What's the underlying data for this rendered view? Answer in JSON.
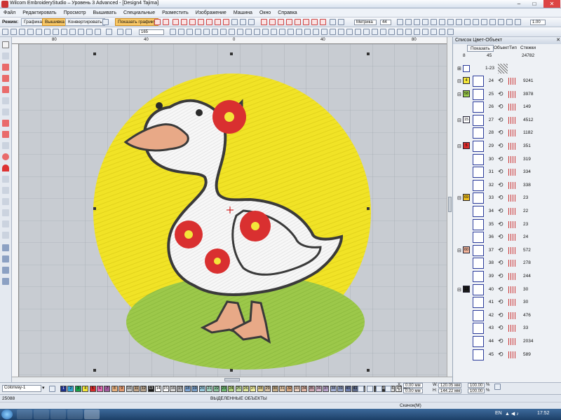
{
  "window": {
    "title": "Wilcom EmbroideryStudio – Уровень 3 Advanced - [Design4     Tajima]"
  },
  "menu": [
    "Файл",
    "Редактировать",
    "Просмотр",
    "Вышивать",
    "Специальные",
    "Разместить",
    "Изображение",
    "Машина",
    "Окно",
    "Справка"
  ],
  "toolbar1": {
    "mode_label": "Режим:",
    "modes": [
      "Графика",
      "Вышивка",
      "Конвертировать"
    ],
    "active_mode": "Вышивка",
    "show_graphic_label": "Показать графику",
    "machine_value": "Метрика",
    "number_value": "44",
    "zoom_value": "1.00"
  },
  "toolbar2": {
    "count_value": "165"
  },
  "ruler_top": [
    "80",
    "40",
    "0",
    "40",
    "80"
  ],
  "panel": {
    "title": "Список Цвет-Объект",
    "show_label": "Показать",
    "col_object": "Объект",
    "col_type": "Тип",
    "col_stitches": "Стежки",
    "stat_colors": "8",
    "stat_objects": "45",
    "stat_total": "24782",
    "group_label": "1-23",
    "rows": [
      {
        "color": "4",
        "num": "24",
        "stitches": "9241",
        "color_hex": "#f4e63a"
      },
      {
        "color": "58",
        "num": "25",
        "stitches": "3978",
        "color_hex": "#9ccd4c"
      },
      {
        "color": "",
        "num": "26",
        "stitches": "149",
        "color_hex": ""
      },
      {
        "color": "15",
        "num": "27",
        "stitches": "4512",
        "color_hex": "#ffffff"
      },
      {
        "color": "",
        "num": "28",
        "stitches": "1182",
        "color_hex": ""
      },
      {
        "color": "5",
        "num": "29",
        "stitches": "351",
        "color_hex": "#d72a2a"
      },
      {
        "color": "",
        "num": "30",
        "stitches": "319",
        "color_hex": ""
      },
      {
        "color": "",
        "num": "31",
        "stitches": "334",
        "color_hex": ""
      },
      {
        "color": "",
        "num": "32",
        "stitches": "338",
        "color_hex": ""
      },
      {
        "color": "69",
        "num": "33",
        "stitches": "23",
        "color_hex": "#f0c020"
      },
      {
        "color": "",
        "num": "34",
        "stitches": "22",
        "color_hex": ""
      },
      {
        "color": "",
        "num": "35",
        "stitches": "23",
        "color_hex": ""
      },
      {
        "color": "",
        "num": "36",
        "stitches": "24",
        "color_hex": ""
      },
      {
        "color": "60",
        "num": "37",
        "stitches": "572",
        "color_hex": "#f2b49a"
      },
      {
        "color": "",
        "num": "38",
        "stitches": "278",
        "color_hex": ""
      },
      {
        "color": "",
        "num": "39",
        "stitches": "244",
        "color_hex": ""
      },
      {
        "color": "13",
        "num": "40",
        "stitches": "30",
        "color_hex": "#1a1a1a"
      },
      {
        "color": "",
        "num": "41",
        "stitches": "30",
        "color_hex": ""
      },
      {
        "color": "",
        "num": "42",
        "stitches": "476",
        "color_hex": ""
      },
      {
        "color": "",
        "num": "43",
        "stitches": "33",
        "color_hex": ""
      },
      {
        "color": "",
        "num": "44",
        "stitches": "2034",
        "color_hex": ""
      },
      {
        "color": "",
        "num": "45",
        "stitches": "589",
        "color_hex": ""
      }
    ]
  },
  "bottom": {
    "colorway": "Colorway-1",
    "swatches": [
      {
        "n": "1",
        "c": "#1c2f8a"
      },
      {
        "n": "2",
        "c": "#34a6d6"
      },
      {
        "n": "3",
        "c": "#1aa04a"
      },
      {
        "n": "4",
        "c": "#f4e63a"
      },
      {
        "n": "5",
        "c": "#d72a2a"
      },
      {
        "n": "6",
        "c": "#e36bb5"
      },
      {
        "n": "7",
        "c": "#a05a9c"
      },
      {
        "n": "8",
        "c": "#e8b07d"
      },
      {
        "n": "9",
        "c": "#e49b72"
      },
      {
        "n": "10",
        "c": "#c7c7c7"
      },
      {
        "n": "11",
        "c": "#c4a78a"
      },
      {
        "n": "12",
        "c": "#b8a58f"
      },
      {
        "n": "13",
        "c": "#1a1a1a"
      },
      {
        "n": "14",
        "c": "#ffffff"
      },
      {
        "n": "15",
        "c": "#ffffff"
      },
      {
        "n": "16",
        "c": "#d9d9d9"
      },
      {
        "n": "17",
        "c": "#aeaeae"
      },
      {
        "n": "18",
        "c": "#7fa8d8"
      },
      {
        "n": "19",
        "c": "#7aa0c9"
      },
      {
        "n": "20",
        "c": "#9acbe0"
      },
      {
        "n": "21",
        "c": "#a6d6c6"
      },
      {
        "n": "22",
        "c": "#88c29b"
      },
      {
        "n": "23",
        "c": "#6fba73"
      },
      {
        "n": "24",
        "c": "#b6d87c"
      },
      {
        "n": "25",
        "c": "#c5e0a0"
      },
      {
        "n": "26",
        "c": "#e0e89a"
      },
      {
        "n": "27",
        "c": "#f0ed9a"
      },
      {
        "n": "28",
        "c": "#e9d792"
      },
      {
        "n": "29",
        "c": "#d8c3a5"
      },
      {
        "n": "30",
        "c": "#c9b08a"
      },
      {
        "n": "31",
        "c": "#e7c9a8"
      },
      {
        "n": "32",
        "c": "#d9a982"
      },
      {
        "n": "33",
        "c": "#f0d4c2"
      },
      {
        "n": "34",
        "c": "#e3b7a5"
      },
      {
        "n": "35",
        "c": "#cfa6b0"
      },
      {
        "n": "36",
        "c": "#d8b8d1"
      },
      {
        "n": "37",
        "c": "#b7a1c9"
      },
      {
        "n": "38",
        "c": "#a6b3d9"
      },
      {
        "n": "39",
        "c": "#92a2c9"
      },
      {
        "n": "40",
        "c": "#6e7faf"
      },
      {
        "n": "41",
        "c": "#5e6a8a"
      },
      {
        "n": "42",
        "c": "#8d8d8d"
      },
      {
        "n": "43",
        "c": "#6b6b6b"
      },
      {
        "n": "44",
        "c": "#4d4d4d"
      },
      {
        "n": "45",
        "c": "#2f2f2f"
      },
      {
        "n": "46",
        "c": "#dcdcdc"
      },
      {
        "n": "47",
        "c": "#f2f2f2"
      },
      {
        "n": "48",
        "c": "#e0e0e0"
      }
    ],
    "x_label": "X:",
    "x_value": "0.00 мм",
    "y_label": "Y:",
    "y_value": "0.00 мм",
    "w_label": "W:",
    "w_value": "120.05 мм",
    "h_label": "H:",
    "h_value": "144.22 мм",
    "scale_w": "100.00",
    "scale_h": "100.00",
    "scale_unit": "%"
  },
  "status": {
    "left": "25088",
    "center": "ВЫДЕЛЕННЫЕ ОБЪЕКТЫ",
    "bottom_center": "Скачок(М)"
  },
  "taskbar": {
    "lang": "EN",
    "time": "17:52"
  }
}
